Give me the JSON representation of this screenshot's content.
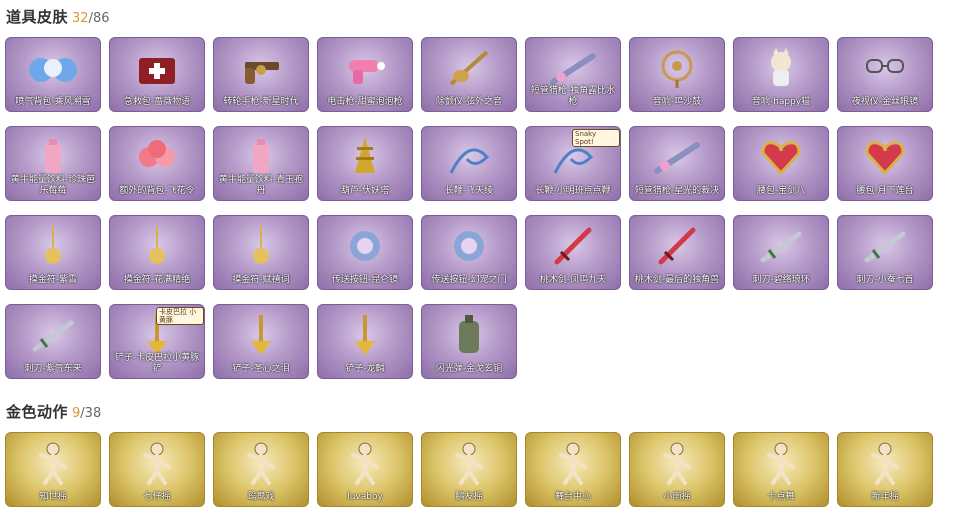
{
  "sections": [
    {
      "title": "道具皮肤",
      "owned": "32",
      "total": "/86",
      "items": [
        {
          "label": "喷气背包-乘风溯雪",
          "icon": "jetpack-icon"
        },
        {
          "label": "急救包-蔷薇物语",
          "icon": "first-aid-kit-icon"
        },
        {
          "label": "转轮手枪-新星时代",
          "icon": "revolver-icon"
        },
        {
          "label": "电击枪-甜蜜泡泡枪",
          "icon": "stun-gun-icon"
        },
        {
          "label": "除颤仪-弦外之音",
          "icon": "defibrillator-icon"
        },
        {
          "label": "短管猎枪-独角露比水枪",
          "icon": "shotgun-icon"
        },
        {
          "label": "音响-鸣沙鼓",
          "icon": "speaker-icon"
        },
        {
          "label": "音响-happy猫",
          "icon": "speaker-cat-icon"
        },
        {
          "label": "夜视仪-金丝眼镜",
          "icon": "night-vision-goggles-icon"
        },
        {
          "label": "黄牛能量饮料-珍珠芭乐莓莓",
          "icon": "energy-drink-icon"
        },
        {
          "label": "额外的背包-飞花令",
          "icon": "backpack-icon"
        },
        {
          "label": "黄牛能量饮料-青玉孢丹",
          "icon": "energy-drink-icon"
        },
        {
          "label": "葫芦-伏妖塔",
          "icon": "gourd-tower-icon"
        },
        {
          "label": "长鞭-飞天绫",
          "icon": "whip-icon"
        },
        {
          "label": "长鞭-小明班点点鞭",
          "icon": "whip-icon",
          "badge": "Snaky Spot!"
        },
        {
          "label": "短管猎枪-星光的裁决",
          "icon": "shotgun-icon"
        },
        {
          "label": "腰包-宝剑八",
          "icon": "waist-pack-icon"
        },
        {
          "label": "腰包-月下莲台",
          "icon": "waist-pack-icon"
        },
        {
          "label": "摸金符-紫霄",
          "icon": "amulet-icon"
        },
        {
          "label": "摸金符-花满精绝",
          "icon": "amulet-icon"
        },
        {
          "label": "摸金符-赋禧词",
          "icon": "amulet-icon"
        },
        {
          "label": "传送按钮-昆仑镜",
          "icon": "teleport-button-icon"
        },
        {
          "label": "传送按钮-幻宠之门",
          "icon": "teleport-button-icon"
        },
        {
          "label": "桃木剑-凤鸣九天",
          "icon": "sword-icon"
        },
        {
          "label": "桃木剑-最后的独角兽",
          "icon": "sword-icon"
        },
        {
          "label": "刺刀-碧络琅环",
          "icon": "bayonet-icon"
        },
        {
          "label": "刺刀-小蚕七首",
          "icon": "bayonet-icon"
        },
        {
          "label": "刺刀-紫气东来",
          "icon": "bayonet-icon"
        },
        {
          "label": "铲子-卡皮巴拉小黄豚铲",
          "icon": "shovel-icon",
          "badge": "卡皮巴拉 小黄豚"
        },
        {
          "label": "铲子-圣心之泪",
          "icon": "shovel-icon"
        },
        {
          "label": "铲子-龙麟",
          "icon": "shovel-icon"
        },
        {
          "label": "闪光弹-金戈玄铜",
          "icon": "flashbang-icon"
        }
      ]
    },
    {
      "title": "金色动作",
      "owned": "9",
      "total": "/38",
      "items": [
        {
          "label": "知世摇",
          "icon": "emote-figure-icon"
        },
        {
          "label": "七仔摇",
          "icon": "emote-figure-icon"
        },
        {
          "label": "鸳鸯戏",
          "icon": "emote-figure-icon"
        },
        {
          "label": "luvaboy",
          "icon": "emote-figure-icon"
        },
        {
          "label": "鹏友摇",
          "icon": "emote-figure-icon"
        },
        {
          "label": "舞台中心",
          "icon": "emote-figure-icon"
        },
        {
          "label": "小雨摇",
          "icon": "emote-figure-icon"
        },
        {
          "label": "卡点舞",
          "icon": "emote-figure-icon"
        },
        {
          "label": "新年摇",
          "icon": "emote-figure-icon"
        }
      ]
    }
  ]
}
